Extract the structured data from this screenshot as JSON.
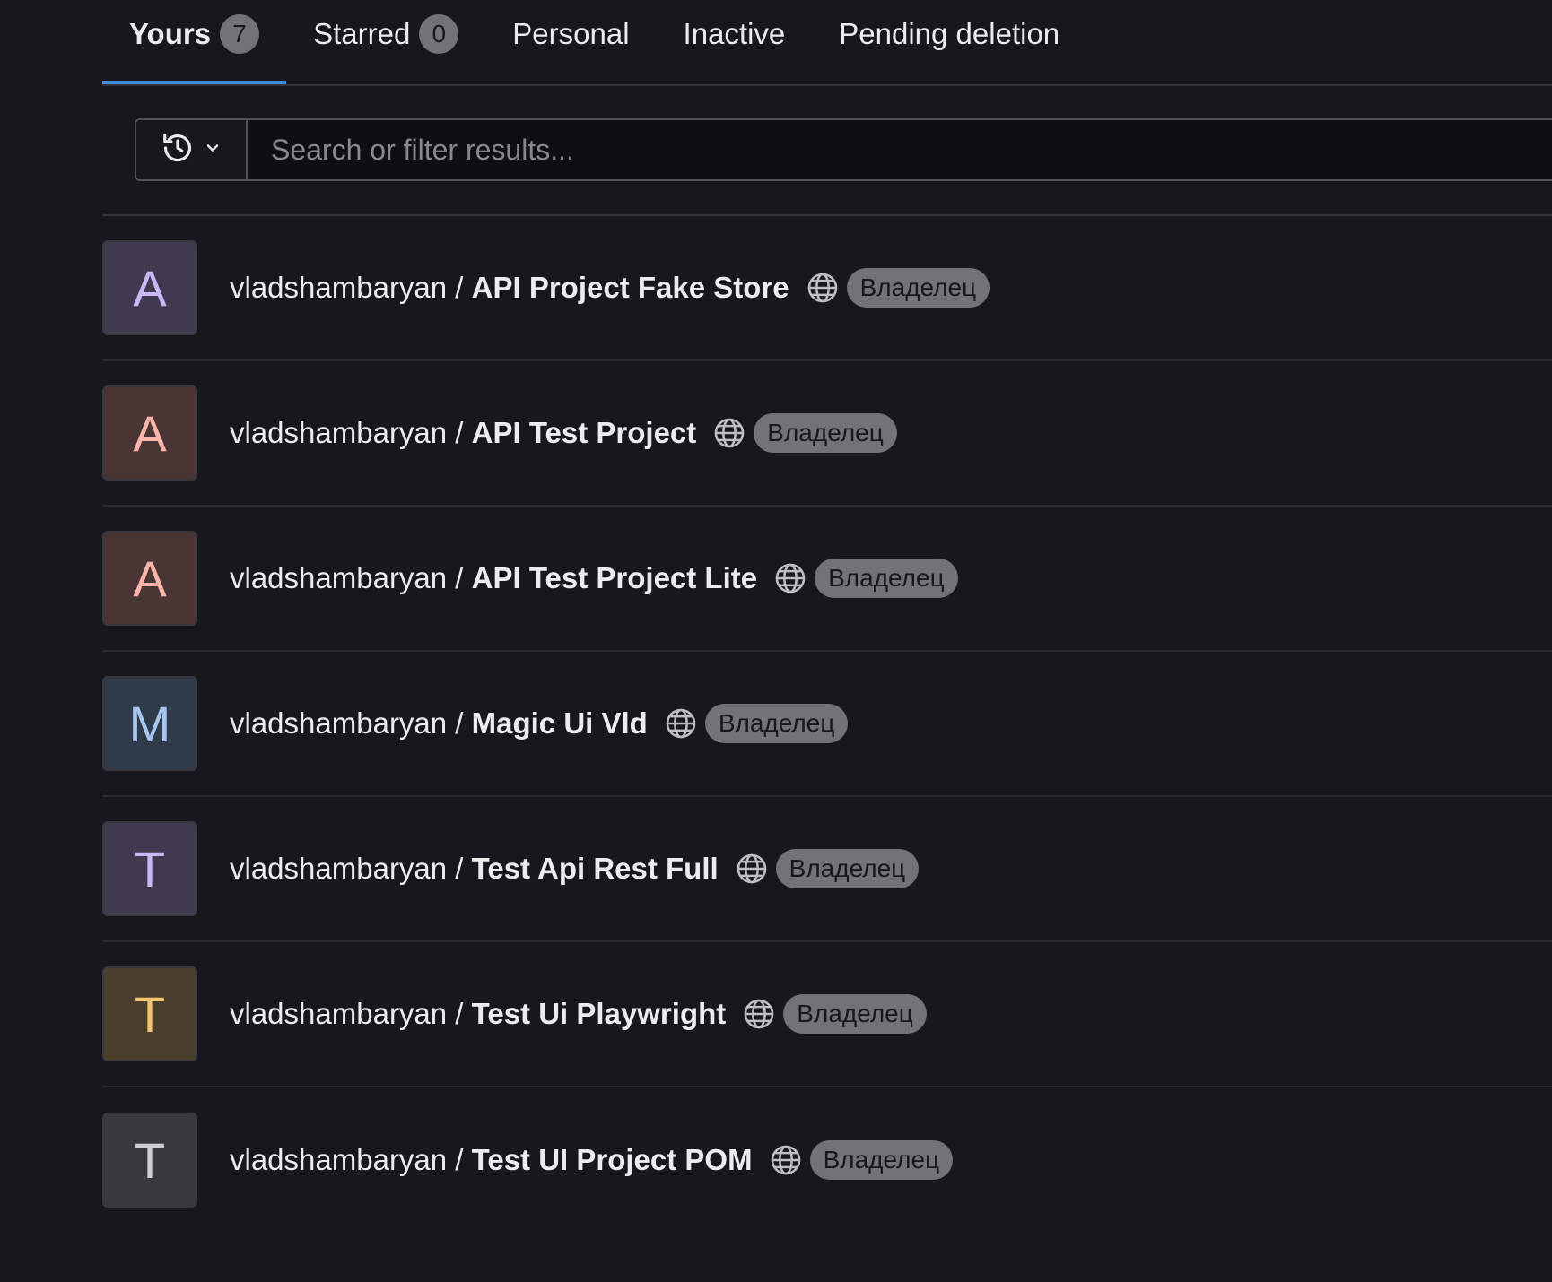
{
  "tabs": [
    {
      "label": "Yours",
      "count": "7",
      "active": true
    },
    {
      "label": "Starred",
      "count": "0",
      "active": false
    },
    {
      "label": "Personal",
      "count": null,
      "active": false
    },
    {
      "label": "Inactive",
      "count": null,
      "active": false
    },
    {
      "label": "Pending deletion",
      "count": null,
      "active": false
    }
  ],
  "search": {
    "placeholder": "Search or filter results...",
    "value": "",
    "history_icon": "history-icon",
    "dropdown_icon": "chevron-down-icon"
  },
  "projects": [
    {
      "namespace": "vladshambaryan / ",
      "name": "API Project Fake Store",
      "avatar_letter": "A",
      "avatar_bg": "#3f3a4f",
      "avatar_fg": "#c9b8f5",
      "visibility_icon": "globe-icon",
      "role": "Владелец"
    },
    {
      "namespace": "vladshambaryan / ",
      "name": "API Test Project",
      "avatar_letter": "A",
      "avatar_bg": "#4a3535",
      "avatar_fg": "#fcb5aa",
      "visibility_icon": "globe-icon",
      "role": "Владелец"
    },
    {
      "namespace": "vladshambaryan / ",
      "name": "API Test Project Lite",
      "avatar_letter": "A",
      "avatar_bg": "#4a3535",
      "avatar_fg": "#fcb5aa",
      "visibility_icon": "globe-icon",
      "role": "Владелец"
    },
    {
      "namespace": "vladshambaryan / ",
      "name": "Magic Ui Vld",
      "avatar_letter": "M",
      "avatar_bg": "#2f3a4a",
      "avatar_fg": "#a8c7f0",
      "visibility_icon": "globe-icon",
      "role": "Владелец"
    },
    {
      "namespace": "vladshambaryan / ",
      "name": "Test Api Rest Full",
      "avatar_letter": "T",
      "avatar_bg": "#3f3a4f",
      "avatar_fg": "#c9b8f5",
      "visibility_icon": "globe-icon",
      "role": "Владелец"
    },
    {
      "namespace": "vladshambaryan / ",
      "name": "Test Ui Playwright",
      "avatar_letter": "T",
      "avatar_bg": "#4a3e2d",
      "avatar_fg": "#f5c46f",
      "visibility_icon": "globe-icon",
      "role": "Владелец"
    },
    {
      "namespace": "vladshambaryan / ",
      "name": "Test UI Project POM",
      "avatar_letter": "T",
      "avatar_bg": "#3a393f",
      "avatar_fg": "#d0cfd4",
      "visibility_icon": "globe-icon",
      "role": "Владелец"
    }
  ],
  "colors": {
    "background": "#18171d",
    "active_tab_underline": "#428fdc",
    "badge_bg": "#737278"
  }
}
